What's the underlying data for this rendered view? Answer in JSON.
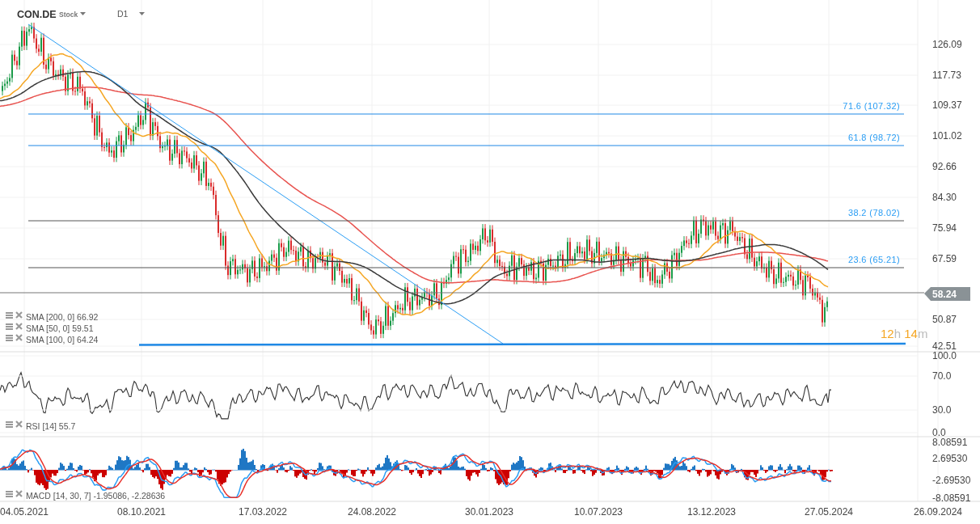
{
  "header": {
    "symbol": "CON.DE",
    "type": "Stock",
    "interval": "D1"
  },
  "price_axis": [
    "126.09",
    "117.73",
    "109.37",
    "101.02",
    "92.66",
    "84.30",
    "75.94",
    "67.59",
    "50.87",
    "42.51"
  ],
  "fib_levels": [
    {
      "label": "71.6 (107.32)"
    },
    {
      "label": "61.8 (98.72)"
    },
    {
      "label": "38.2 (78.02)"
    },
    {
      "label": "23.6 (65.21)"
    }
  ],
  "last_price": "58.24",
  "countdown": {
    "hours": "12",
    "hours_unit": "h",
    "minutes": "14",
    "minutes_unit": "m"
  },
  "indicators": [
    {
      "label": "SMA [200, 0] 66.92",
      "color": "#e8534f"
    },
    {
      "label": "SMA [50, 0] 59.51",
      "color": "#f5a623"
    },
    {
      "label": "SMA [100, 0] 64.24",
      "color": "#3a3a3a"
    }
  ],
  "rsi": {
    "label": "RSI [14] 55.7",
    "axis": [
      "100.0",
      "70.0",
      "30.0",
      "0.0"
    ]
  },
  "macd": {
    "label": "MACD [14, 30, 7] -1.95086, -2.28636",
    "axis": [
      "8.08591",
      "2.69530",
      "-2.69530",
      "-8.08591"
    ]
  },
  "dates": [
    "04.05.2021",
    "08.10.2021",
    "17.03.2022",
    "24.08.2022",
    "30.01.2023",
    "10.07.2023",
    "13.12.2023",
    "27.05.2024",
    "26.09.2024"
  ]
}
